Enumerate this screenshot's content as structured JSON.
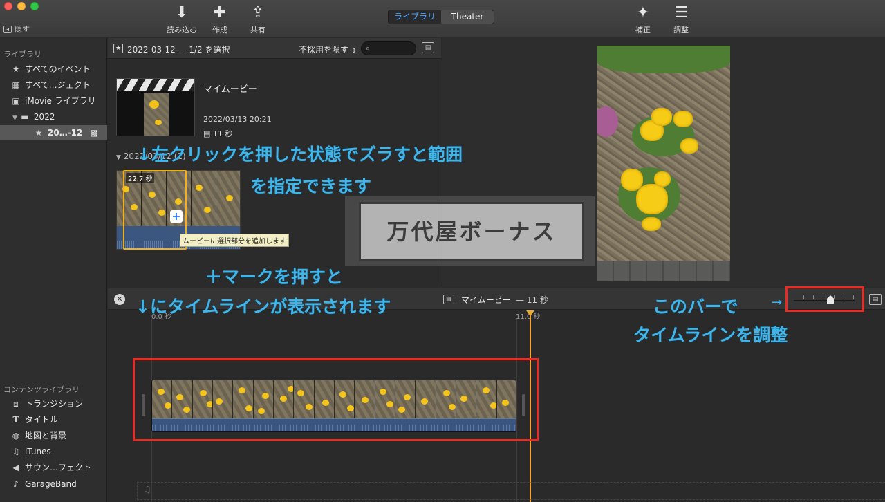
{
  "toolbar": {
    "hide_label": "隠す",
    "import_label": "読み込む",
    "create_label": "作成",
    "share_label": "共有",
    "enhance_label": "補正",
    "adjust_label": "調整",
    "view_tabs": [
      "ライブラリ",
      "Theater"
    ],
    "active_tab": "ライブラリ"
  },
  "sidebar": {
    "library_header": "ライブラリ",
    "items": [
      {
        "label": "すべてのイベント",
        "icon": "star-icon"
      },
      {
        "label": "すべて…ジェクト",
        "icon": "film-icon"
      },
      {
        "label": "iMovie ライブラリ",
        "icon": "grid-icon"
      },
      {
        "label": "2022",
        "icon": "folder-icon"
      },
      {
        "label": "20…-12",
        "icon": "star-icon",
        "selected": true
      }
    ],
    "content_header": "コンテンツライブラリ",
    "content_items": [
      {
        "label": "トランジション",
        "icon": "transition-icon"
      },
      {
        "label": "タイトル",
        "icon": "title-icon"
      },
      {
        "label": "地図と背景",
        "icon": "globe-icon"
      },
      {
        "label": "iTunes",
        "icon": "music-note-icon"
      },
      {
        "label": "サウン…フェクト",
        "icon": "speaker-icon"
      },
      {
        "label": "GarageBand",
        "icon": "guitar-icon"
      }
    ]
  },
  "browser": {
    "title": "2022-03-12 — 1/2 を選択",
    "filter": "不採用を隠す",
    "movie": {
      "title": "マイムービー",
      "date": "2022/03/13 20:21",
      "duration": "11 秒"
    },
    "event_header": "2022/03/12 (1)",
    "clip_badge": "22.7 秒",
    "tooltip": "ムービーに選択部分を追加します"
  },
  "watermark": "万代屋ボーナス",
  "timeline": {
    "title": "マイムービー",
    "duration": "— 11 秒",
    "ruler_start": "0.0 秒",
    "ruler_end": "11.0 秒",
    "zoom_level": 0.62
  },
  "annotations": {
    "drag_line1": "↓左クリックを押した状態でズラすと範囲",
    "drag_line2": "を指定できます",
    "plus_line1": "＋マークを押すと",
    "plus_line2": "↓にタイムラインが表示されます",
    "bar_line1": "このバーで",
    "bar_line2": "タイムラインを調整",
    "arrow": "→"
  },
  "colors": {
    "accent_blue": "#3fb5ea",
    "highlight_red": "#e62c25",
    "selection_yellow": "#f5b018"
  }
}
